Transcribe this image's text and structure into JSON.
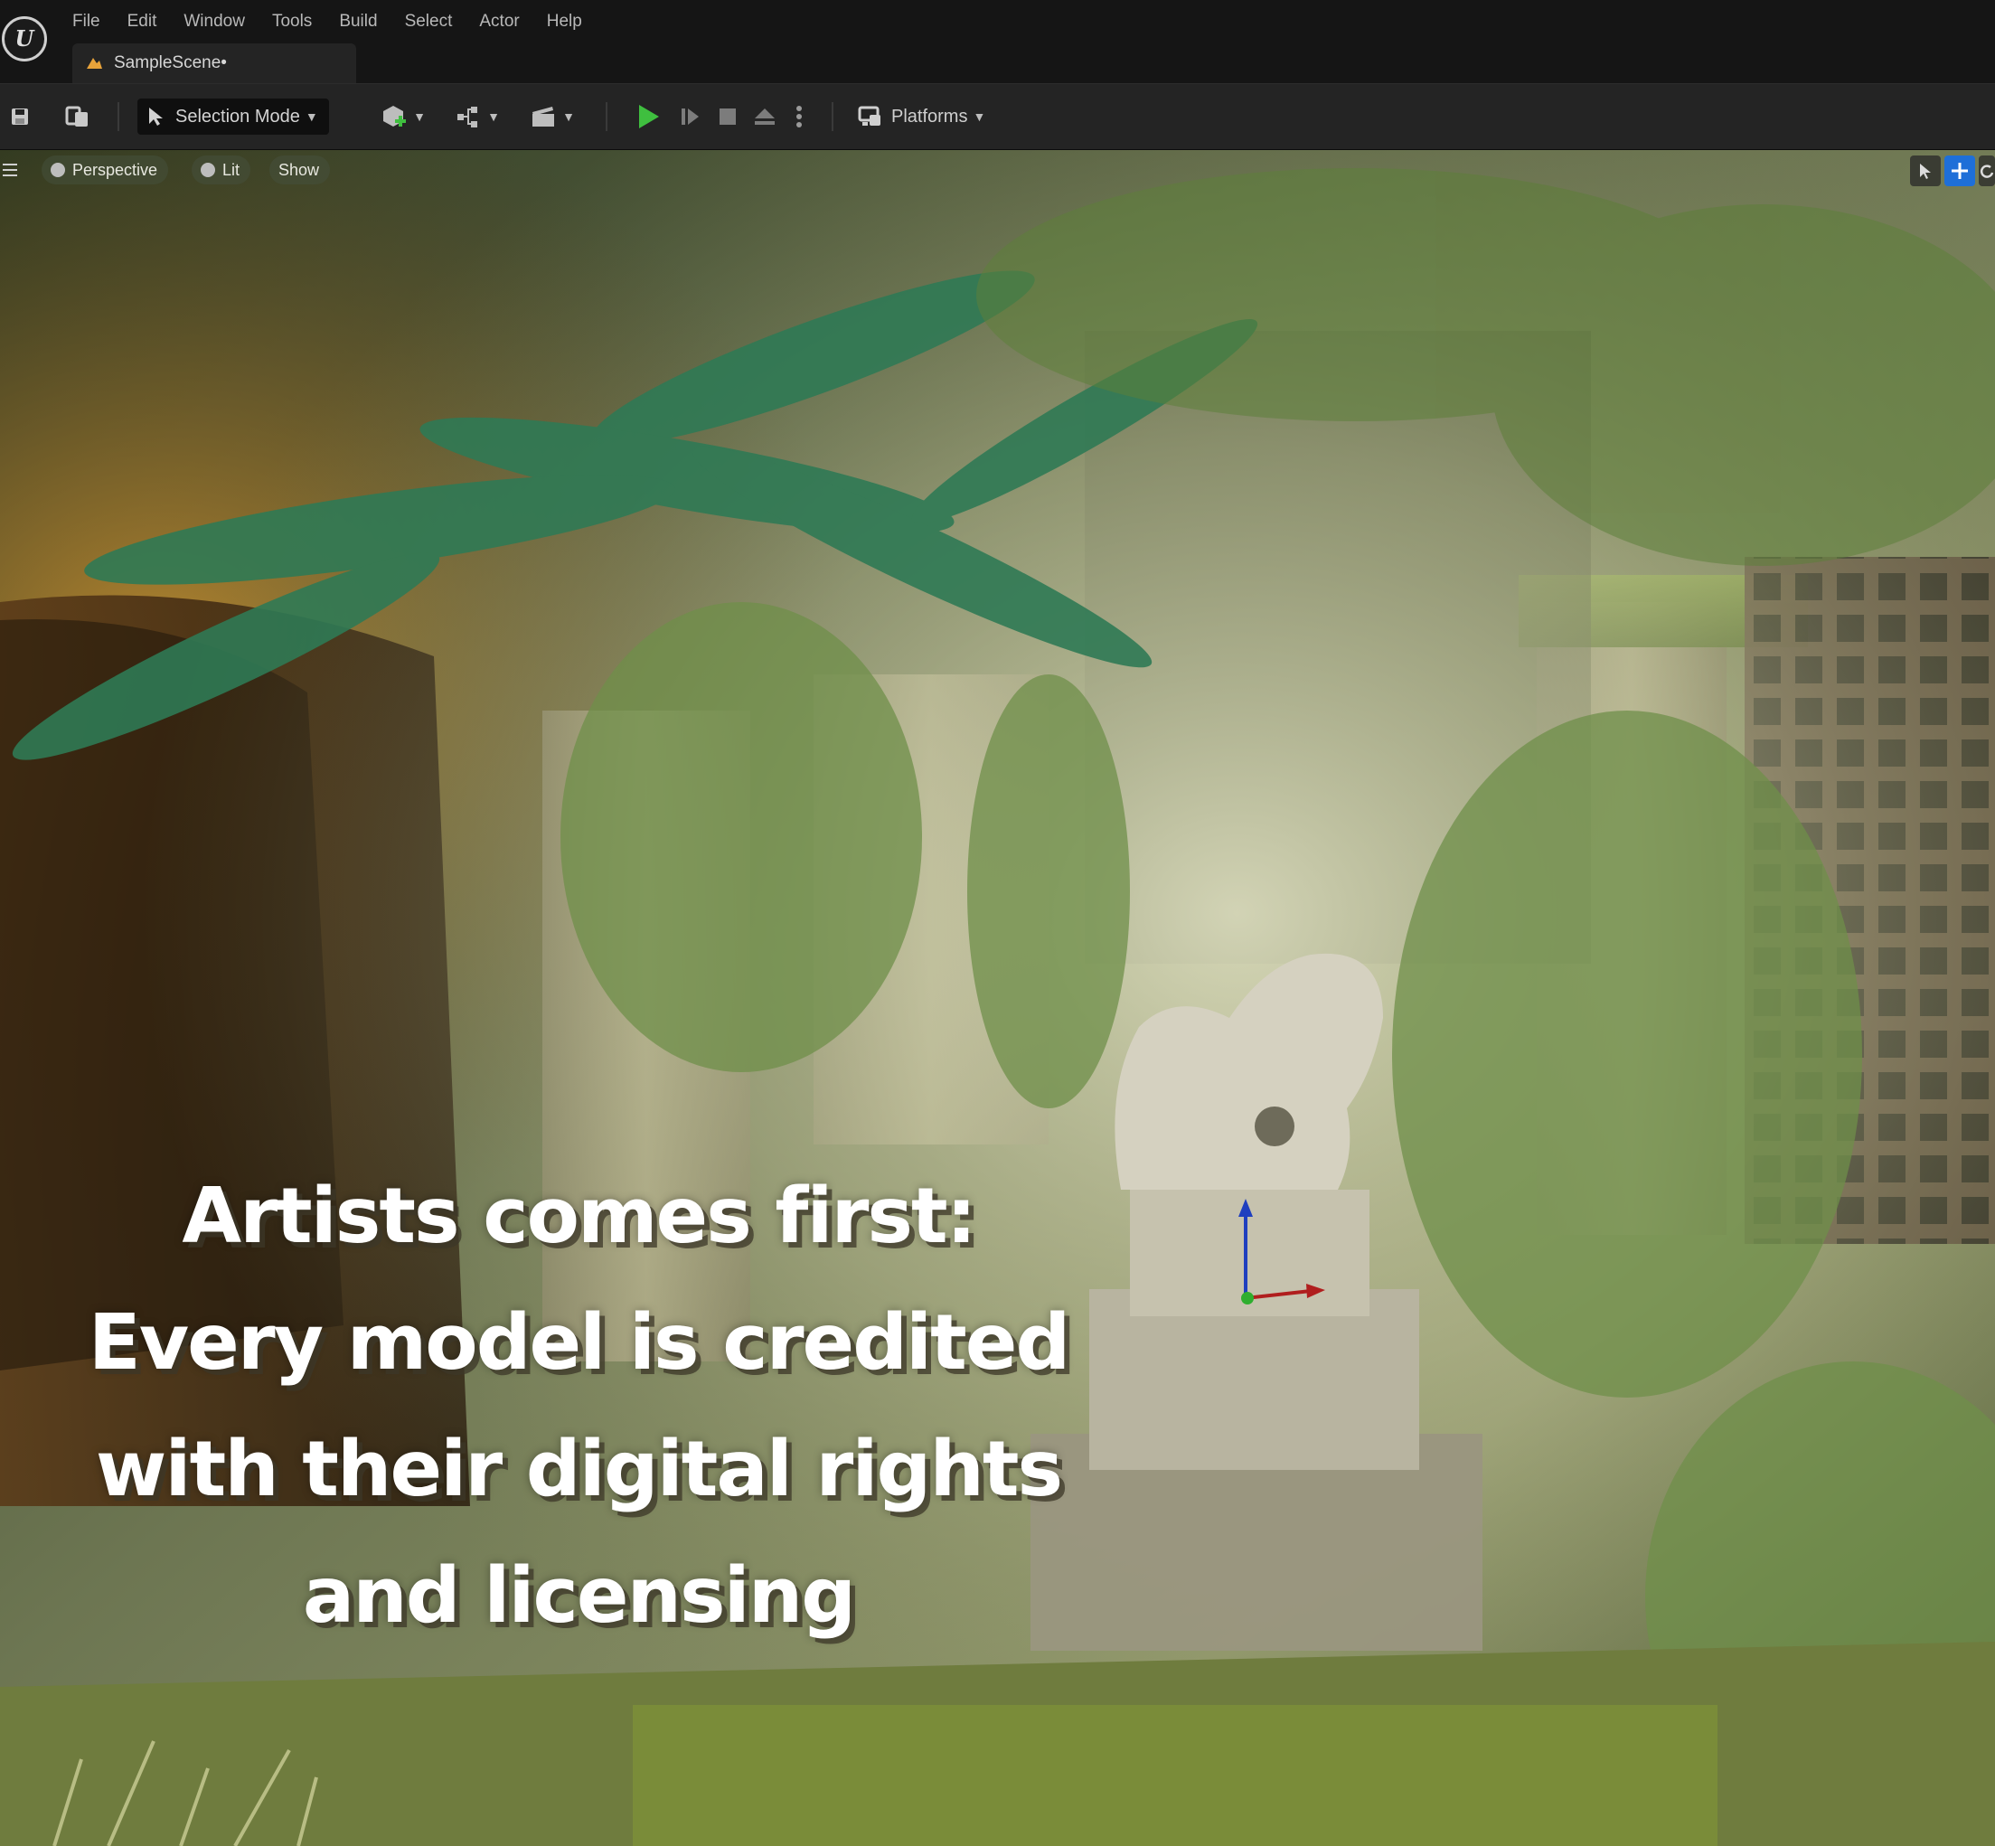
{
  "app": {
    "logo_name": "unreal-engine-logo",
    "logo_glyph": "U"
  },
  "menu": [
    {
      "label": "File"
    },
    {
      "label": "Edit"
    },
    {
      "label": "Window"
    },
    {
      "label": "Tools"
    },
    {
      "label": "Build"
    },
    {
      "label": "Select"
    },
    {
      "label": "Actor"
    },
    {
      "label": "Help"
    }
  ],
  "document_tab": {
    "label": "SampleScene•",
    "icon": "level-icon"
  },
  "toolbar": {
    "selection_mode_label": "Selection Mode",
    "platforms_label": "Platforms",
    "play_color": "#3fbf3f"
  },
  "viewport": {
    "view_mode_label": "Perspective",
    "lighting_label": "Lit",
    "show_label": "Show",
    "active_tool_color": "#1e6fd8"
  },
  "caption": {
    "lines": [
      "Artists comes first:",
      "Every model is credited",
      "with their digital rights",
      "and licensing"
    ]
  }
}
